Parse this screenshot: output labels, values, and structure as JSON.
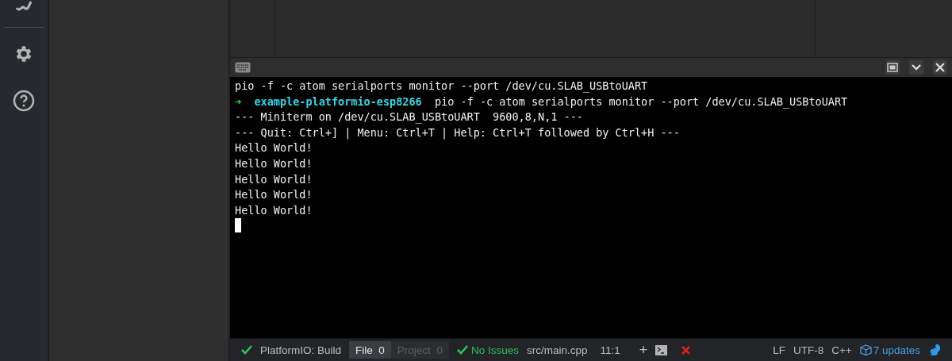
{
  "terminal": {
    "lines": [
      {
        "kind": "plain",
        "text": "pio -f -c atom serialports monitor --port /dev/cu.SLAB_USBtoUART"
      },
      {
        "kind": "prompt",
        "arrow": "➜",
        "dir": "example-platformio-esp8266",
        "text": "pio -f -c atom serialports monitor --port /dev/cu.SLAB_USBtoUART"
      },
      {
        "kind": "plain",
        "text": "--- Miniterm on /dev/cu.SLAB_USBtoUART  9600,8,N,1 ---"
      },
      {
        "kind": "plain",
        "text": "--- Quit: Ctrl+] | Menu: Ctrl+T | Help: Ctrl+T followed by Ctrl+H ---"
      },
      {
        "kind": "plain",
        "text": "Hello World!"
      },
      {
        "kind": "plain",
        "text": "Hello World!"
      },
      {
        "kind": "plain",
        "text": "Hello World!"
      },
      {
        "kind": "plain",
        "text": "Hello World!"
      },
      {
        "kind": "plain",
        "text": "Hello World!"
      }
    ]
  },
  "status_bar": {
    "build": "PlatformIO: Build",
    "tabs": [
      {
        "label": "File",
        "count": "0",
        "selected": true
      },
      {
        "label": "Project",
        "count": "0",
        "selected": false
      }
    ],
    "issues": "No Issues",
    "file": "src/main.cpp",
    "position": "11:1",
    "add": "+",
    "line_ending": "LF",
    "encoding": "UTF-8",
    "grammar": "C++",
    "updates": "7 updates"
  }
}
